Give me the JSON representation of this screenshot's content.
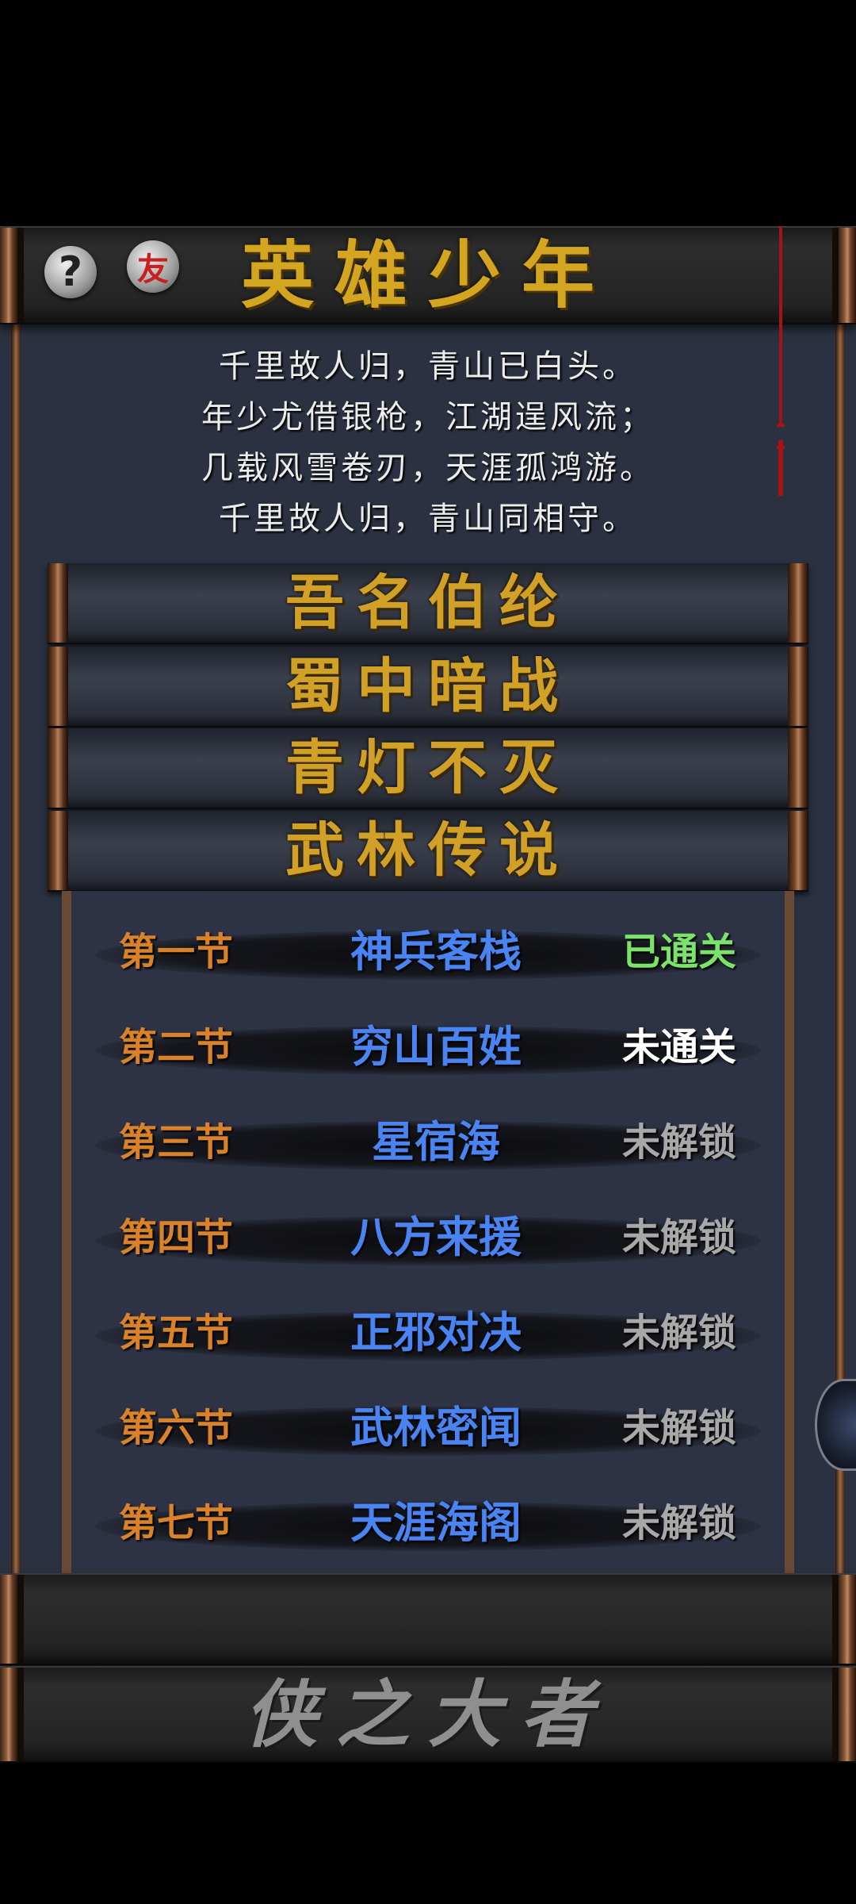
{
  "header": {
    "title": "英雄少年",
    "help_icon": "?",
    "friend_icon": "友"
  },
  "poem": {
    "lines": [
      "千里故人归，青山已白头。",
      "年少尤借银枪，江湖逞风流；",
      "几载风雪卷刃，天涯孤鸿游。",
      "千里故人归，青山同相守。"
    ]
  },
  "chapters": [
    {
      "label": "吾名伯纶"
    },
    {
      "label": "蜀中暗战"
    },
    {
      "label": "青灯不灭"
    },
    {
      "label": "武林传说"
    }
  ],
  "sections": [
    {
      "section": "第一节",
      "name": "神兵客栈",
      "status": "已通关",
      "status_color": "#7be36a"
    },
    {
      "section": "第二节",
      "name": "穷山百姓",
      "status": "未通关",
      "status_color": "#ffffff"
    },
    {
      "section": "第三节",
      "name": "星宿海",
      "status": "未解锁",
      "status_color": "#a8a8a8"
    },
    {
      "section": "第四节",
      "name": "八方来援",
      "status": "未解锁",
      "status_color": "#a8a8a8"
    },
    {
      "section": "第五节",
      "name": "正邪对决",
      "status": "未解锁",
      "status_color": "#a8a8a8"
    },
    {
      "section": "第六节",
      "name": "武林密闻",
      "status": "未解锁",
      "status_color": "#a8a8a8"
    },
    {
      "section": "第七节",
      "name": "天涯海阁",
      "status": "未解锁",
      "status_color": "#a8a8a8"
    }
  ],
  "footer": {
    "title": "侠之大者"
  },
  "colors": {
    "gold": "#d4a521",
    "section_label": "#d9822a",
    "section_name": "#4a84f2"
  }
}
